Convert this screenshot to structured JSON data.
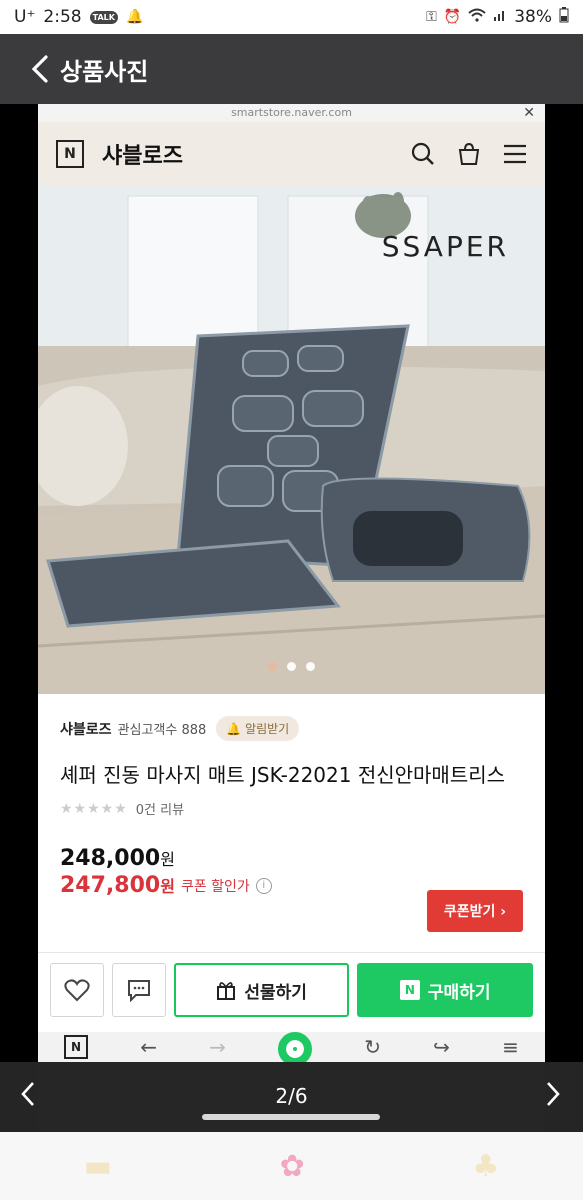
{
  "statusbar": {
    "carrier": "U⁺",
    "time": "2:58",
    "talk_badge": "TALK",
    "battery": "38%"
  },
  "viewer": {
    "title": "상품사진",
    "page_indicator": "2/6"
  },
  "inner": {
    "url": "smartstore.naver.com",
    "store_name": "샤블로즈",
    "store_logo": "N",
    "hero_brand": "SSAPER",
    "carousel_dots": 3,
    "carousel_active": 0
  },
  "product": {
    "seller": "샤블로즈",
    "followers": "관심고객수 888",
    "alarm_label": "알림받기",
    "title": "셰퍼 진동 마사지 매트 JSK-22021 전신안마매트리스",
    "review_count": "0건 리뷰",
    "price": "248,000",
    "price_unit": "원",
    "sale_price": "247,800",
    "sale_label": "쿠폰 할인가",
    "coupon_button": "쿠폰받기 ›",
    "gift_button": "선물하기",
    "buy_button": "구매하기"
  },
  "colors": {
    "accent_green": "#1ec863",
    "sale_red": "#d8343a",
    "header_dark": "#3b3b3d"
  },
  "icons": [
    "search-icon",
    "cart-icon",
    "menu-icon",
    "back-icon",
    "heart-icon",
    "chat-icon",
    "gift-icon",
    "flower-icon"
  ]
}
